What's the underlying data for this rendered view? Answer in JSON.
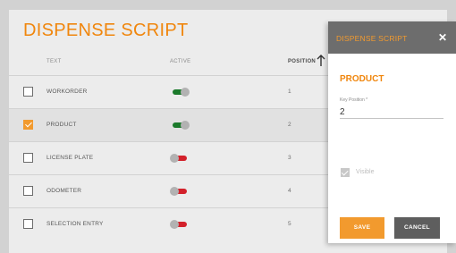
{
  "page": {
    "title": "DISPENSE SCRIPT"
  },
  "table": {
    "columns": {
      "text": "TEXT",
      "active": "ACTIVE",
      "position": "POSITION"
    },
    "sort_icon": "arrow-up-icon",
    "rows": [
      {
        "text": "WORKORDER",
        "active": true,
        "position": "1",
        "checked": false
      },
      {
        "text": "PRODUCT",
        "active": true,
        "position": "2",
        "checked": true
      },
      {
        "text": "LICENSE PLATE",
        "active": false,
        "position": "3",
        "checked": false
      },
      {
        "text": "ODOMETER",
        "active": false,
        "position": "4",
        "checked": false
      },
      {
        "text": "SELECTION ENTRY",
        "active": false,
        "position": "5",
        "checked": false
      }
    ]
  },
  "dialog": {
    "title": "DISPENSE SCRIPT",
    "close_icon": "close-icon",
    "subtitle": "PRODUCT",
    "field": {
      "label": "Key Position *",
      "value": "2"
    },
    "visible": {
      "label": "Visible",
      "checked": true,
      "disabled": true
    },
    "save_label": "SAVE",
    "cancel_label": "CANCEL"
  },
  "colors": {
    "accent": "#f29a2e",
    "toggle_on": "#1b7a2b",
    "toggle_off": "#d3212b",
    "dialog_header": "#6d6d6d"
  }
}
